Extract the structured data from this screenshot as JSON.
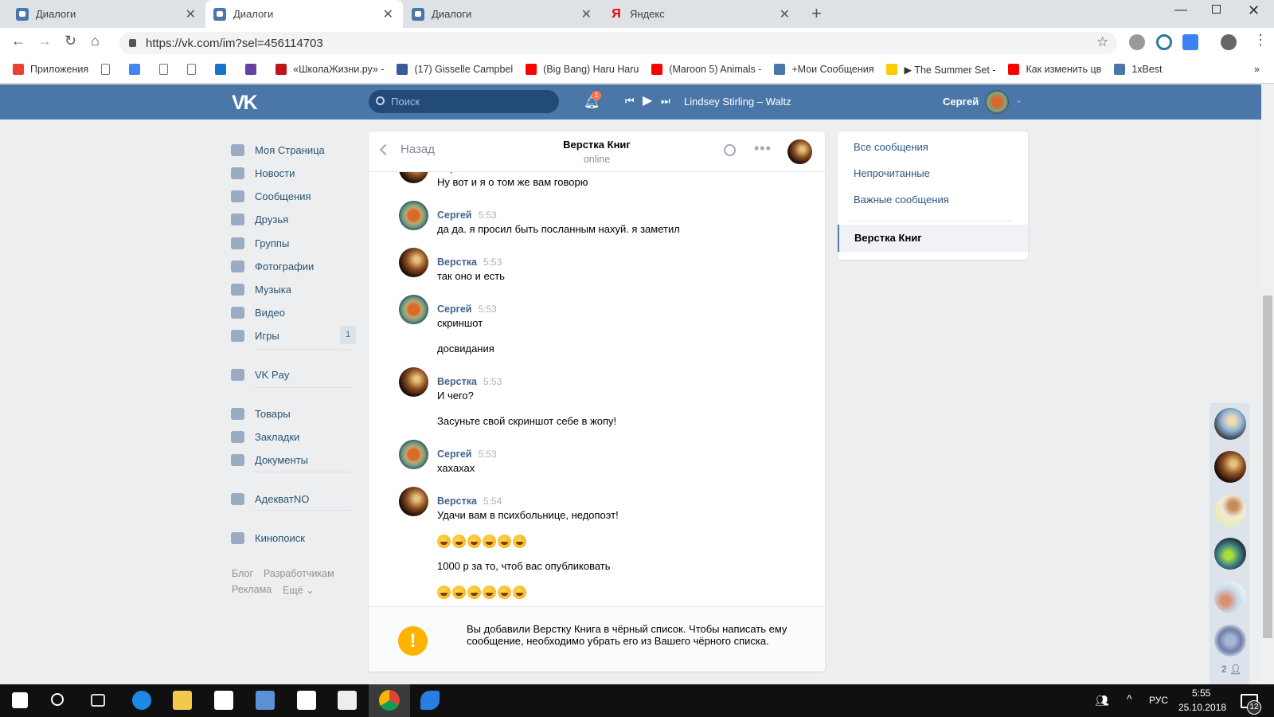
{
  "browser": {
    "tabs": [
      {
        "label": "Диалоги",
        "icon": "vk-messages-icon"
      },
      {
        "label": "Диалоги",
        "icon": "vk-messages-icon",
        "active": true
      },
      {
        "label": "Диалоги",
        "icon": "vk-messages-icon"
      },
      {
        "label": "Яндекс",
        "icon": "yandex-icon"
      }
    ],
    "url": "https://vk.com/im?sel=456114703",
    "bookmarks": [
      {
        "label": "Приложения",
        "color": "#e94235"
      },
      {
        "label": "",
        "color": "#ffffff"
      },
      {
        "label": "",
        "color": "#4285f4"
      },
      {
        "label": "",
        "color": "#ffffff"
      },
      {
        "label": "",
        "color": "#ffffff"
      },
      {
        "label": "",
        "color": "#1a73c8"
      },
      {
        "label": "",
        "color": "#6441a5"
      },
      {
        "label": "«ШколаЖизни.ру» -",
        "color": "#c0141b"
      },
      {
        "label": "(17) Gisselle Campbel",
        "color": "#3b5998"
      },
      {
        "label": "(Big Bang) Haru Haru",
        "color": "#ff0000"
      },
      {
        "label": "(Maroon 5) Animals -",
        "color": "#ff0000"
      },
      {
        "label": "+Мои Сообщения",
        "color": "#4a76a8"
      },
      {
        "label": "▶ The Summer Set -",
        "color": "#ffcc00"
      },
      {
        "label": "Как изменить цв",
        "color": "#ff0000"
      },
      {
        "label": "1xBest",
        "color": "#4a76a8"
      }
    ],
    "more": "»"
  },
  "vk": {
    "logo": "VK",
    "search_placeholder": "Поиск",
    "notifications": "1",
    "track": "Lindsey Stirling – Waltz",
    "user": "Сергей",
    "accent": "#4a76a8"
  },
  "sidebar": {
    "items": [
      {
        "label": "Моя Страница",
        "icon": "home-icon"
      },
      {
        "label": "Новости",
        "icon": "news-icon"
      },
      {
        "label": "Сообщения",
        "icon": "messages-icon"
      },
      {
        "label": "Друзья",
        "icon": "friends-icon"
      },
      {
        "label": "Группы",
        "icon": "groups-icon"
      },
      {
        "label": "Фотографии",
        "icon": "camera-icon"
      },
      {
        "label": "Музыка",
        "icon": "music-icon"
      },
      {
        "label": "Видео",
        "icon": "video-icon"
      },
      {
        "label": "Игры",
        "icon": "gamepad-icon",
        "badge": "1"
      },
      {
        "label": "VK Pay",
        "icon": "vkpay-icon"
      },
      {
        "label": "Товары",
        "icon": "bag-icon"
      },
      {
        "label": "Закладки",
        "icon": "star-icon"
      },
      {
        "label": "Документы",
        "icon": "document-icon"
      },
      {
        "label": "АдекватNO",
        "icon": "groups-icon"
      },
      {
        "label": "Кинопоиск",
        "icon": "apps-icon"
      }
    ],
    "footer": [
      "Блог",
      "Разработчикам",
      "Реклама",
      "Ещё ⌄"
    ]
  },
  "chat": {
    "back": "Назад",
    "title": "Верстка Книг",
    "status": "online",
    "messages": [
      {
        "author": "Верстка",
        "time": "",
        "avatar": "verst",
        "lines": [
          "Ну вот и я о том же вам говорю"
        ]
      },
      {
        "author": "Сергей",
        "time": "5:53",
        "avatar": "serg",
        "lines": [
          "да да. я просил быть посланным нахуй. я заметил"
        ]
      },
      {
        "author": "Верстка",
        "time": "5:53",
        "avatar": "verst",
        "lines": [
          "так оно и есть"
        ]
      },
      {
        "author": "Сергей",
        "time": "5:53",
        "avatar": "serg",
        "lines": [
          "скриншот",
          "досвидания"
        ]
      },
      {
        "author": "Верстка",
        "time": "5:53",
        "avatar": "verst",
        "lines": [
          "И чего?",
          "Засуньте свой скриншот себе в жопу!"
        ]
      },
      {
        "author": "Сергей",
        "time": "5:53",
        "avatar": "serg",
        "lines": [
          "хахахах"
        ]
      },
      {
        "author": "Верстка",
        "time": "5:54",
        "avatar": "verst",
        "lines": [
          "Удачи вам в психбольнице, недопоэт!",
          {
            "emoji": "rofl-emoji-icon",
            "count": 6
          },
          "1000 р за то, чтоб вас опубликовать",
          {
            "emoji": "rofl-emoji-icon",
            "count": 6
          }
        ]
      }
    ],
    "blacklist_notice": "Вы добавили Верстку Книга в чёрный список. Чтобы написать ему сообщение, необходимо убрать его из Вашего чёрного списка.",
    "warning_color": "#ffb300"
  },
  "filters": {
    "items": [
      "Все сообщения",
      "Непрочитанные",
      "Важные сообщения"
    ],
    "active_dialog": "Верстка Книг"
  },
  "friends_online": {
    "count": "2"
  },
  "taskbar": {
    "lang": "РУС",
    "time": "5:55",
    "date": "25.10.2018",
    "notifications": "12"
  }
}
